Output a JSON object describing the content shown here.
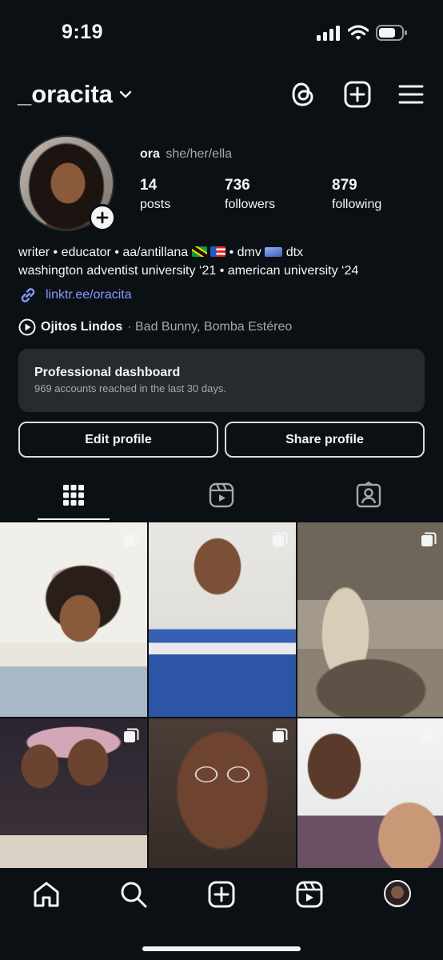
{
  "status_bar": {
    "time": "9:19"
  },
  "header": {
    "username": "_oracita"
  },
  "profile": {
    "name": "ora",
    "pronouns": "she/her/ella",
    "stats": [
      {
        "value": "14",
        "label": "posts"
      },
      {
        "value": "736",
        "label": "followers"
      },
      {
        "value": "879",
        "label": "following"
      }
    ],
    "bio_line1_a": "writer • educator • aa/antillana",
    "bio_line1_b": "• dmv",
    "bio_line1_c": "dtx",
    "bio_line2": "washington adventist university ‘21 • american university ‘24",
    "link": "linktr.ee/oracita",
    "music_song": "Ojitos Lindos",
    "music_artists": "· Bad Bunny, Bomba Estéreo"
  },
  "dashboard": {
    "title": "Professional dashboard",
    "subtitle": "969 accounts reached in the last 30 days."
  },
  "buttons": {
    "edit": "Edit profile",
    "share": "Share profile"
  },
  "icons": {
    "header": [
      "threads-icon",
      "add-post-icon",
      "menu-icon"
    ],
    "tabs": [
      "grid-icon",
      "reels-icon",
      "tagged-icon"
    ],
    "nav": [
      "home-icon",
      "search-icon",
      "create-icon",
      "reels-icon",
      "profile-avatar"
    ]
  },
  "colors": {
    "background": "#0b1014",
    "link": "#8a9bff",
    "card": "#262b30"
  }
}
